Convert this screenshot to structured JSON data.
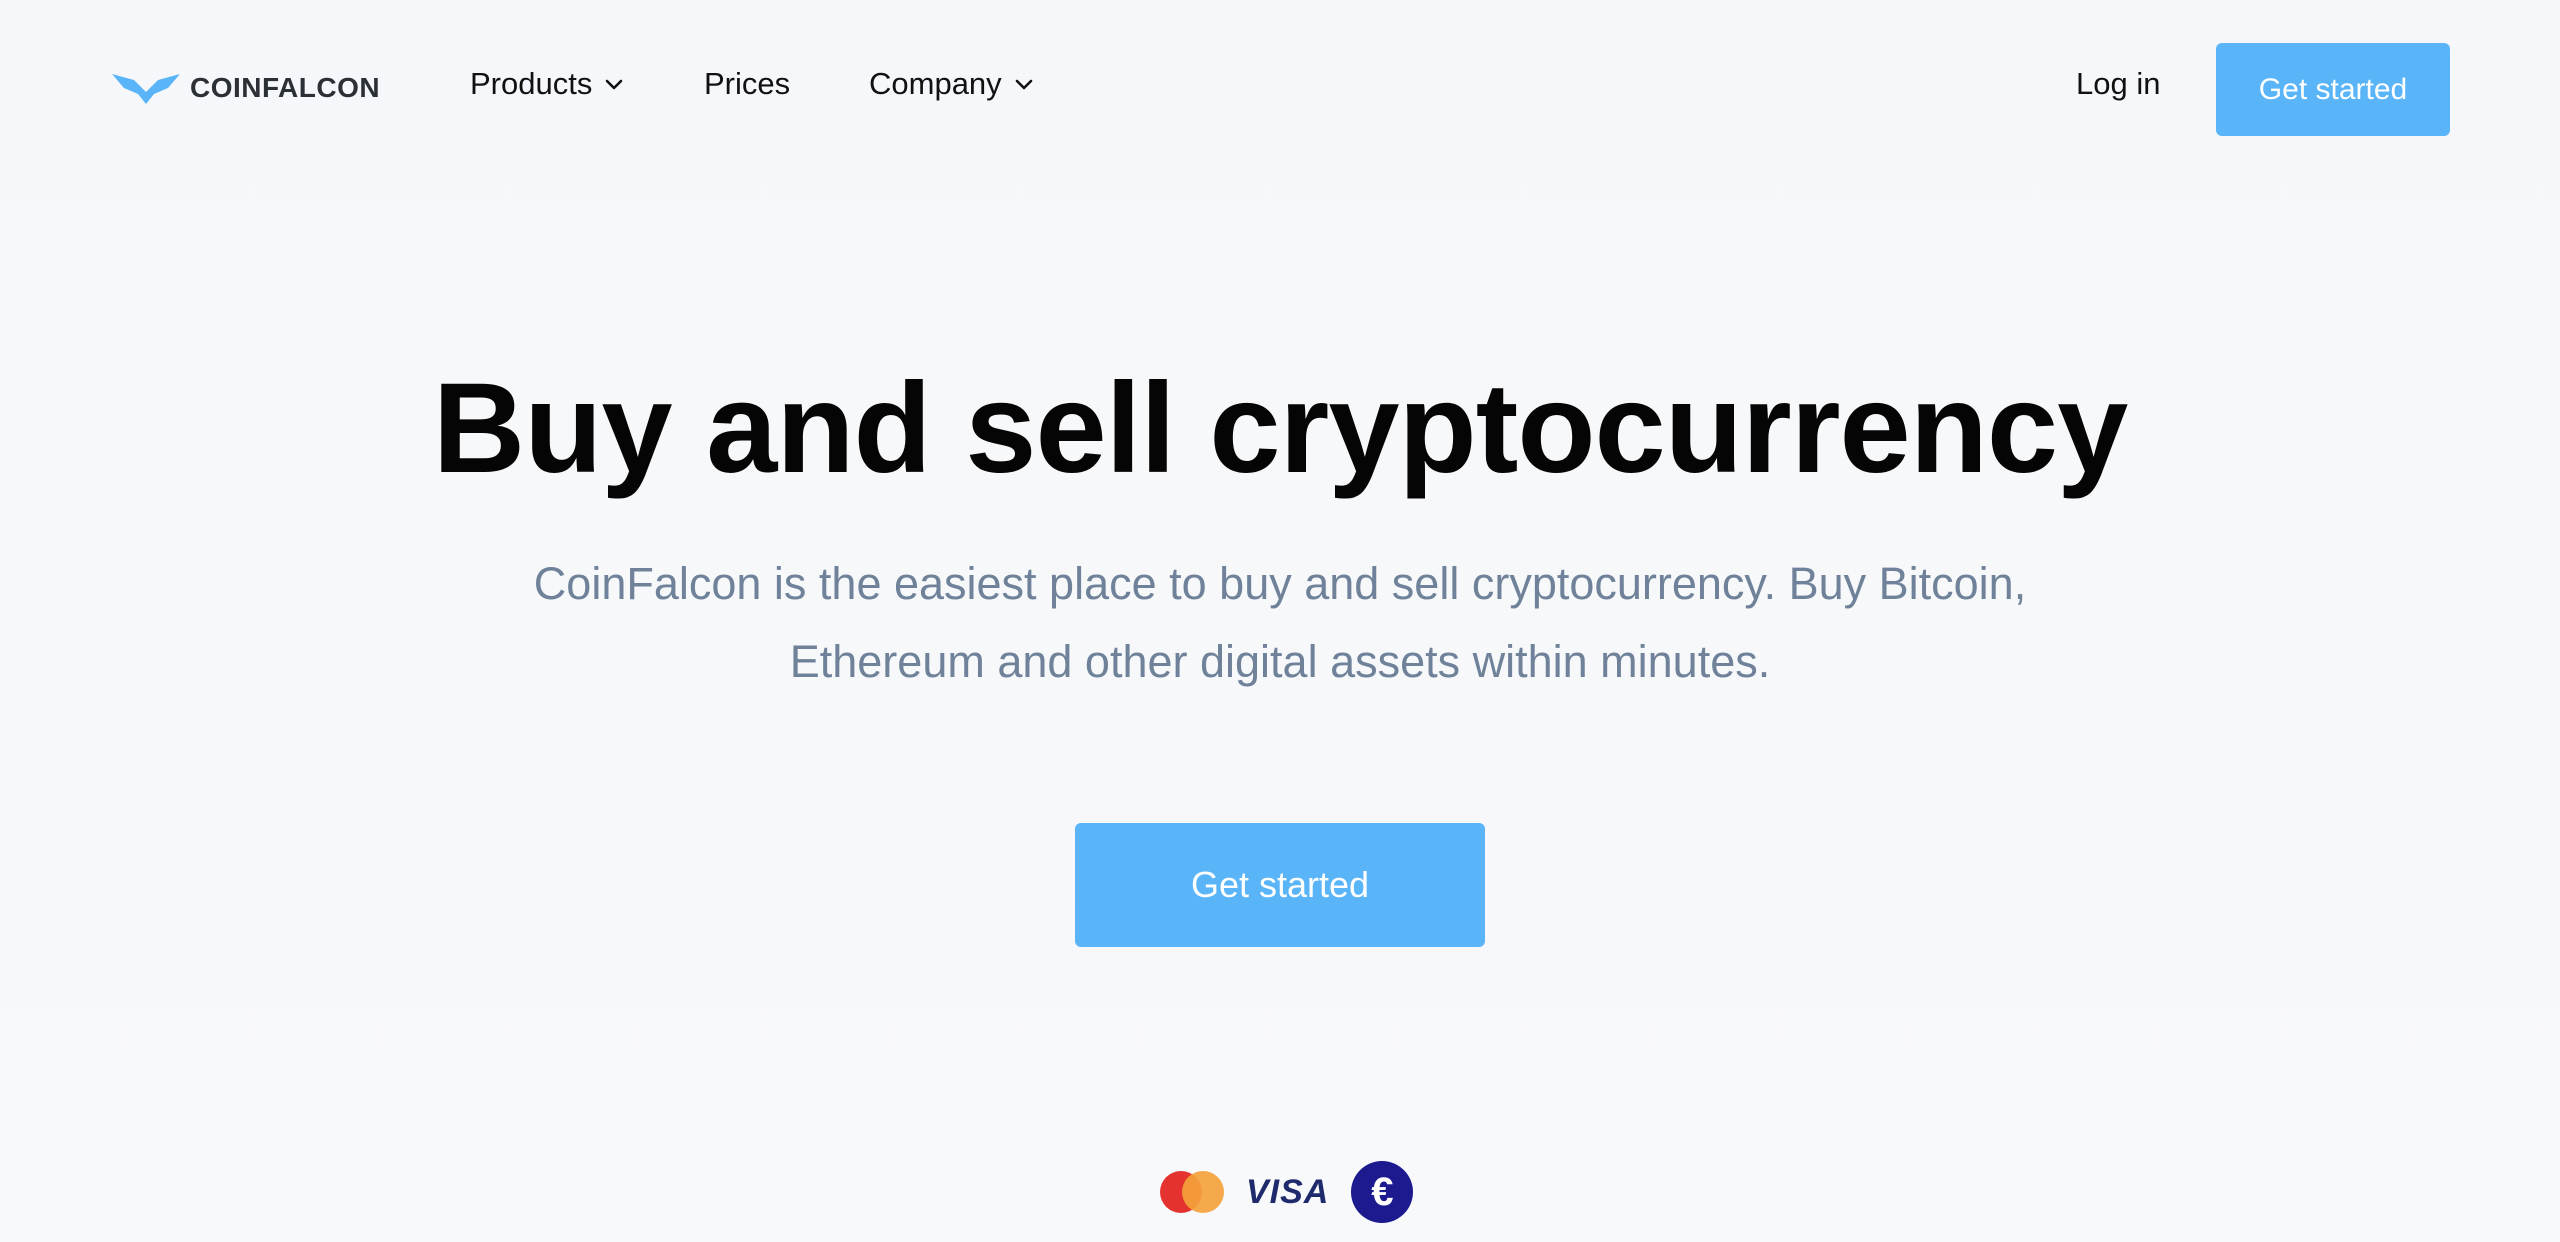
{
  "header": {
    "brand": "COINFALCON",
    "nav": [
      {
        "label": "Products",
        "has_dropdown": true
      },
      {
        "label": "Prices",
        "has_dropdown": false
      },
      {
        "label": "Company",
        "has_dropdown": true
      }
    ],
    "login_label": "Log in",
    "cta_label": "Get started"
  },
  "hero": {
    "title": "Buy and sell cryptocurrency",
    "subtitle": "CoinFalcon is the easiest place to buy and sell cryptocurrency. Buy Bitcoin, Ethereum and other digital assets within minutes.",
    "cta_label": "Get started"
  },
  "payments": {
    "visa_label": "VISA",
    "euro_symbol": "€",
    "icons": [
      "mastercard-icon",
      "visa-icon",
      "euro-icon"
    ]
  },
  "colors": {
    "accent": "#5ab4f8",
    "subtitle_text": "#6f8299",
    "background": "#f6f8fa"
  }
}
